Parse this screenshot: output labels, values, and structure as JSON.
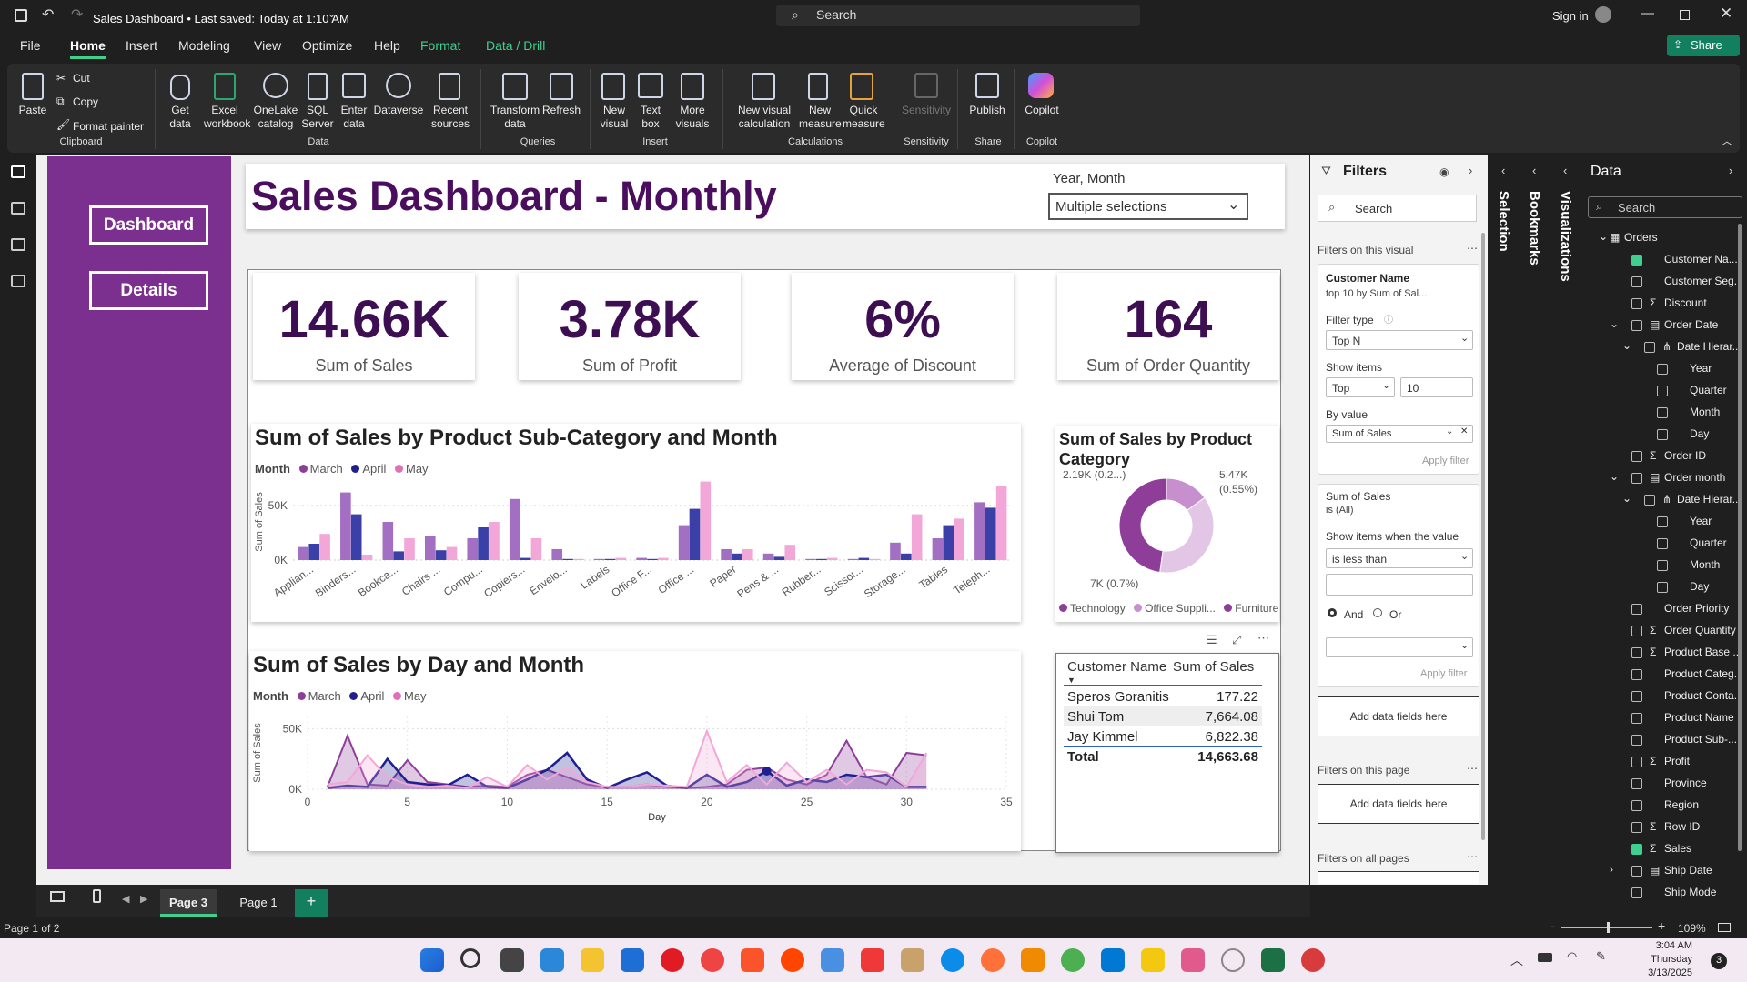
{
  "window": {
    "title": "Sales Dashboard • Last saved: Today at 1:10 AM",
    "search_placeholder": "Search",
    "sign_in": "Sign in",
    "share": "Share"
  },
  "menu": [
    "File",
    "Home",
    "Insert",
    "Modeling",
    "View",
    "Optimize",
    "Help",
    "Format",
    "Data / Drill"
  ],
  "ribbon": {
    "clipboard": {
      "paste": "Paste",
      "cut": "Cut",
      "copy": "Copy",
      "format_painter": "Format painter",
      "group": "Clipboard"
    },
    "data": {
      "items": [
        "Get data",
        "Excel workbook",
        "OneLake catalog",
        "SQL Server",
        "Enter data",
        "Dataverse",
        "Recent sources"
      ],
      "group": "Data"
    },
    "queries": {
      "items": [
        "Transform data",
        "Refresh"
      ],
      "group": "Queries"
    },
    "insert": {
      "items": [
        "New visual",
        "Text box",
        "More visuals"
      ],
      "group": "Insert"
    },
    "calculations": {
      "items": [
        "New visual calculation",
        "New measure",
        "Quick measure"
      ],
      "group": "Calculations"
    },
    "sensitivity": {
      "items": [
        "Sensitivity"
      ],
      "group": "Sensitivity"
    },
    "share": {
      "items": [
        "Publish"
      ],
      "group": "Share"
    },
    "copilot": {
      "items": [
        "Copilot"
      ],
      "group": "Copilot"
    }
  },
  "nav": {
    "dashboard": "Dashboard",
    "details": "Details"
  },
  "report": {
    "title": "Sales Dashboard - Monthly",
    "slicer": {
      "label": "Year, Month",
      "value": "Multiple selections"
    },
    "kpis": [
      {
        "value": "14.66K",
        "label": "Sum of Sales"
      },
      {
        "value": "3.78K",
        "label": "Sum of Profit"
      },
      {
        "value": "6%",
        "label": "Average of Discount"
      },
      {
        "value": "164",
        "label": "Sum of Order Quantity"
      }
    ]
  },
  "chart_data": [
    {
      "type": "bar",
      "title": "Sum of Sales by Product Sub-Category and Month",
      "legend_title": "Month",
      "ylabel": "Sum of Sales",
      "yticks": [
        "50K",
        "0K"
      ],
      "ylim": [
        0,
        70000
      ],
      "categories": [
        "Applian...",
        "Binders...",
        "Bookca...",
        "Chairs ...",
        "Compu...",
        "Copiers...",
        "Envelo...",
        "Labels",
        "Office F...",
        "Office ...",
        "Paper",
        "Pens & ...",
        "Rubber...",
        "Scissor...",
        "Storage...",
        "Tables",
        "Teleph..."
      ],
      "series": [
        {
          "name": "March",
          "color": "#a26fc2",
          "values": [
            12000,
            62000,
            35000,
            22000,
            20000,
            56000,
            10000,
            1000,
            2000,
            32000,
            10000,
            6000,
            1000,
            1000,
            16000,
            20000,
            53000
          ]
        },
        {
          "name": "April",
          "color": "#3b3fa8",
          "values": [
            15000,
            42000,
            8000,
            9000,
            30000,
            2000,
            1000,
            1000,
            1000,
            47000,
            6000,
            3000,
            1000,
            2000,
            6000,
            32000,
            48000
          ]
        },
        {
          "name": "May",
          "color": "#f2a7d8",
          "values": [
            24000,
            5000,
            20000,
            12000,
            35000,
            20000,
            1000,
            2000,
            2000,
            72000,
            10000,
            14000,
            2000,
            1000,
            42000,
            38000,
            68000
          ]
        }
      ]
    },
    {
      "type": "pie",
      "title": "Sum of Sales by Product Category",
      "labels": [
        "2.19K (0.2...)",
        "5.47K (0.55%)",
        "7K (0.7%)"
      ],
      "series": [
        {
          "name": "Technology",
          "color": "#c78fce",
          "value": 2190
        },
        {
          "name": "Office Suppli...",
          "color": "#e3c6e6",
          "value": 5470
        },
        {
          "name": "Furniture",
          "color": "#8e3d99",
          "value": 7000
        }
      ]
    },
    {
      "type": "line",
      "title": "Sum of Sales by Day and Month",
      "legend_title": "Month",
      "xlabel": "Day",
      "ylabel": "Sum of Sales",
      "xticks": [
        0,
        5,
        10,
        15,
        20,
        25,
        30,
        35
      ],
      "yticks": [
        "50K",
        "0K"
      ],
      "xlim": [
        0,
        35
      ],
      "ylim": [
        0,
        60000
      ],
      "x": [
        1,
        2,
        3,
        4,
        5,
        6,
        7,
        8,
        9,
        10,
        11,
        12,
        13,
        14,
        15,
        16,
        17,
        18,
        19,
        20,
        21,
        22,
        23,
        24,
        25,
        26,
        27,
        28,
        29,
        30,
        31
      ],
      "series": [
        {
          "name": "March",
          "color": "#8e3d99",
          "values": [
            2000,
            44000,
            4000,
            3000,
            24000,
            6000,
            4000,
            2000,
            3000,
            2000,
            12000,
            16000,
            10000,
            4000,
            2000,
            2000,
            4000,
            2000,
            1000,
            2000,
            4000,
            16000,
            18000,
            8000,
            4000,
            12000,
            40000,
            10000,
            4000,
            30000,
            28000
          ]
        },
        {
          "name": "April",
          "color": "#1f1f8f",
          "values": [
            1000,
            3000,
            2000,
            25000,
            6000,
            4000,
            3000,
            12000,
            2000,
            1000,
            8000,
            16000,
            30000,
            8000,
            1000,
            8000,
            14000,
            3000,
            1000,
            12000,
            2000,
            6000,
            15000,
            3000,
            8000,
            6000,
            12000,
            10000,
            12000,
            2000,
            2000
          ]
        },
        {
          "name": "May",
          "color": "#f2a7d8",
          "values": [
            4000,
            6000,
            28000,
            10000,
            4000,
            2000,
            3000,
            1000,
            10000,
            2000,
            20000,
            8000,
            18000,
            6000,
            2000,
            2000,
            4000,
            3000,
            2000,
            48000,
            6000,
            20000,
            4000,
            22000,
            6000,
            16000,
            4000,
            16000,
            14000,
            2000,
            30000
          ]
        }
      ]
    }
  ],
  "table": {
    "headers": [
      "Customer Name",
      "Sum of Sales"
    ],
    "rows": [
      [
        "Speros Goranitis",
        "177.22"
      ],
      [
        "Shui Tom",
        "7,664.08"
      ],
      [
        "Jay Kimmel",
        "6,822.38"
      ]
    ],
    "total": [
      "Total",
      "14,663.68"
    ]
  },
  "filters": {
    "title": "Filters",
    "search": "Search",
    "on_visual": "Filters on this visual",
    "customer": {
      "name": "Customer Name",
      "desc": "top 10 by Sum of Sal...",
      "filter_type_label": "Filter type",
      "filter_type": "Top N",
      "show_items_label": "Show items",
      "show_dir": "Top",
      "show_n": "10",
      "by_value_label": "By value",
      "by_value": "Sum of Sales",
      "apply": "Apply filter"
    },
    "sales": {
      "name": "Sum of Sales",
      "desc": "is (All)",
      "cond_label": "Show items when the value",
      "cond": "is less than",
      "and": "And",
      "or": "Or",
      "apply": "Apply filter"
    },
    "add_fields": "Add data fields here",
    "on_page": "Filters on this page",
    "on_all": "Filters on all pages"
  },
  "panes": {
    "selection": "Selection",
    "bookmarks": "Bookmarks",
    "visualizations": "Visualizations",
    "data": "Data",
    "data_search": "Search"
  },
  "data_fields": [
    {
      "label": "Orders",
      "level": 0,
      "kind": "table",
      "checked": false
    },
    {
      "label": "Customer Na...",
      "level": 1,
      "kind": "field",
      "checked": true
    },
    {
      "label": "Customer Seg...",
      "level": 1,
      "kind": "field",
      "checked": false
    },
    {
      "label": "Discount",
      "level": 1,
      "kind": "sigma",
      "checked": false
    },
    {
      "label": "Order Date",
      "level": 1,
      "kind": "date",
      "checked": false
    },
    {
      "label": "Date Hierar...",
      "level": 2,
      "kind": "hier",
      "checked": false
    },
    {
      "label": "Year",
      "level": 3,
      "kind": "field",
      "checked": false
    },
    {
      "label": "Quarter",
      "level": 3,
      "kind": "field",
      "checked": false
    },
    {
      "label": "Month",
      "level": 3,
      "kind": "field",
      "checked": false
    },
    {
      "label": "Day",
      "level": 3,
      "kind": "field",
      "checked": false
    },
    {
      "label": "Order ID",
      "level": 1,
      "kind": "sigma",
      "checked": false
    },
    {
      "label": "Order month",
      "level": 1,
      "kind": "date",
      "checked": false
    },
    {
      "label": "Date Hierar...",
      "level": 2,
      "kind": "hier",
      "checked": false
    },
    {
      "label": "Year",
      "level": 3,
      "kind": "field",
      "checked": false
    },
    {
      "label": "Quarter",
      "level": 3,
      "kind": "field",
      "checked": false
    },
    {
      "label": "Month",
      "level": 3,
      "kind": "field",
      "checked": false
    },
    {
      "label": "Day",
      "level": 3,
      "kind": "field",
      "checked": false
    },
    {
      "label": "Order Priority",
      "level": 1,
      "kind": "field",
      "checked": false
    },
    {
      "label": "Order Quantity",
      "level": 1,
      "kind": "sigma",
      "checked": false
    },
    {
      "label": "Product Base ...",
      "level": 1,
      "kind": "sigma",
      "checked": false
    },
    {
      "label": "Product Categ...",
      "level": 1,
      "kind": "field",
      "checked": false
    },
    {
      "label": "Product Conta...",
      "level": 1,
      "kind": "field",
      "checked": false
    },
    {
      "label": "Product Name",
      "level": 1,
      "kind": "field",
      "checked": false
    },
    {
      "label": "Product Sub-...",
      "level": 1,
      "kind": "field",
      "checked": false
    },
    {
      "label": "Profit",
      "level": 1,
      "kind": "sigma",
      "checked": false
    },
    {
      "label": "Province",
      "level": 1,
      "kind": "field",
      "checked": false
    },
    {
      "label": "Region",
      "level": 1,
      "kind": "field",
      "checked": false
    },
    {
      "label": "Row ID",
      "level": 1,
      "kind": "sigma",
      "checked": false
    },
    {
      "label": "Sales",
      "level": 1,
      "kind": "sigma",
      "checked": true
    },
    {
      "label": "Ship Date",
      "level": 1,
      "kind": "date",
      "checked": false
    },
    {
      "label": "Ship Mode",
      "level": 1,
      "kind": "field",
      "checked": false
    }
  ],
  "pages": {
    "tabs": [
      "Page 3",
      "Page 1"
    ],
    "add": "+",
    "status": "Page 1 of 2",
    "zoom": "109%"
  },
  "taskbar": {
    "time": "3:04 AM",
    "day": "Thursday",
    "date": "3/13/2025",
    "notifications": "3"
  }
}
